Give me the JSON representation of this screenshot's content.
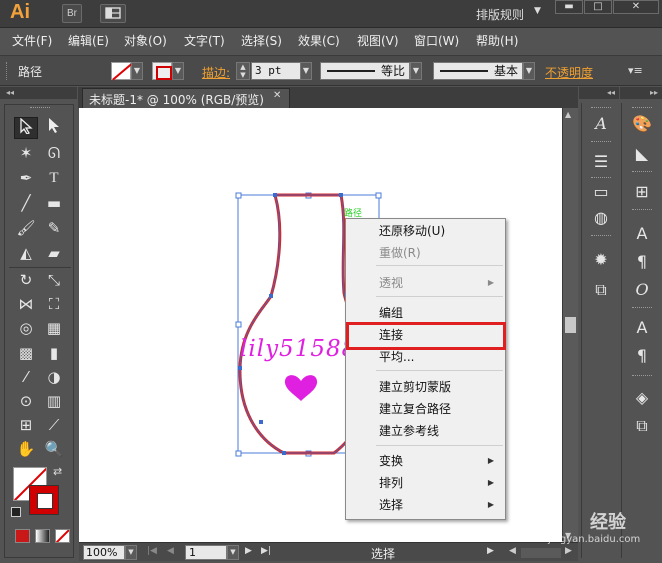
{
  "app": {
    "logo": "Ai",
    "bridge_label": "Br",
    "workspace": "排版规则"
  },
  "menu": [
    "文件(F)",
    "编辑(E)",
    "对象(O)",
    "文字(T)",
    "选择(S)",
    "效果(C)",
    "视图(V)",
    "窗口(W)",
    "帮助(H)"
  ],
  "control_bar": {
    "selection_label": "路径",
    "stroke_link": "描边:",
    "stroke_weight": "3 pt",
    "profile_1": "等比",
    "profile_2": "基本",
    "opacity_link": "不透明度",
    "stroke_color": "#d00000"
  },
  "document": {
    "tab_title": "未标题-1* @ 100% (RGB/预览)",
    "path_hint": "路径",
    "artwork_text": "lily51588",
    "accent_color": "#e020e0"
  },
  "context_menu": {
    "items": [
      {
        "label": "还原移动(U)",
        "disabled": false,
        "submenu": false
      },
      {
        "label": "重做(R)",
        "disabled": true,
        "submenu": false
      },
      {
        "label": "透视",
        "disabled": true,
        "submenu": true
      },
      {
        "label": "编组",
        "disabled": false,
        "submenu": false
      },
      {
        "label": "连接",
        "disabled": false,
        "submenu": false,
        "highlighted": true
      },
      {
        "label": "平均...",
        "disabled": false,
        "submenu": false
      },
      {
        "label": "建立剪切蒙版",
        "disabled": false,
        "submenu": false
      },
      {
        "label": "建立复合路径",
        "disabled": false,
        "submenu": false
      },
      {
        "label": "建立参考线",
        "disabled": false,
        "submenu": false
      },
      {
        "label": "变换",
        "disabled": false,
        "submenu": true
      },
      {
        "label": "排列",
        "disabled": false,
        "submenu": true
      },
      {
        "label": "选择",
        "disabled": false,
        "submenu": true
      }
    ]
  },
  "status_bar": {
    "zoom": "100%",
    "page": "1",
    "status": "选择"
  },
  "watermark": {
    "brand": "Bai",
    "brand_cn": "经验",
    "url": "jingyan.baidu.com"
  }
}
